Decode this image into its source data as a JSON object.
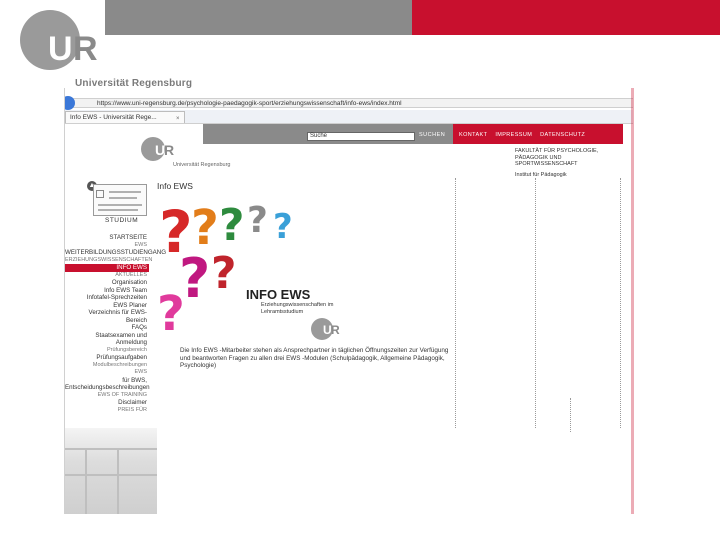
{
  "slide": {
    "brand_gray": "#8a8a8a",
    "brand_red": "#c8102e",
    "logo_letters_left": "U",
    "logo_letters_right": "R",
    "university_name": "Universität Regensburg"
  },
  "browser": {
    "url": "https://www.uni-regensburg.de/psychologie-paedagogik-sport/erziehungswissenschaft/info-ews/index.html",
    "tab_title": "Info EWS - Universität Rege...",
    "tab_close": "×"
  },
  "site_header": {
    "search_placeholder": "Suche",
    "search_button": "SUCHEN",
    "top_links": [
      "KONTAKT",
      "IMPRESSUM",
      "DATENSCHUTZ"
    ],
    "small_logo_name": "Universität Regensburg",
    "faculty_lines": [
      "FAKULTÄT FÜR PSYCHOLOGIE,",
      "PÄDAGOGIK UND",
      "SPORTWISSENSCHAFT"
    ],
    "institute": "Institut für Pädagogik"
  },
  "sidebar": {
    "section_label": "STUDIUM",
    "items": [
      {
        "label": "STARTSEITE",
        "active": false,
        "tiny": false
      },
      {
        "label": "EWS",
        "active": false,
        "tiny": true
      },
      {
        "label": "WEITERBILDUNGSSTUDIENGANG",
        "active": false,
        "tiny": false
      },
      {
        "label": "ERZIEHUNGSWISSENSCHAFTEN",
        "active": false,
        "tiny": true
      },
      {
        "label": "INFO EWS",
        "active": true,
        "tiny": false
      },
      {
        "label": "AKTUELLES",
        "active": false,
        "tiny": true
      },
      {
        "label": "Organisation",
        "active": false,
        "tiny": false
      },
      {
        "label": "Info EWS Team",
        "active": false,
        "tiny": false
      },
      {
        "label": "Infotafel-Sprechzeiten",
        "active": false,
        "tiny": false
      },
      {
        "label": "EWS Planer",
        "active": false,
        "tiny": false
      },
      {
        "label": "Verzeichnis für EWS-",
        "active": false,
        "tiny": false
      },
      {
        "label": "Bereich",
        "active": false,
        "tiny": false
      },
      {
        "label": "FAQs",
        "active": false,
        "tiny": false
      },
      {
        "label": "Staatsexamen und",
        "active": false,
        "tiny": false
      },
      {
        "label": "Anmeldung",
        "active": false,
        "tiny": false
      },
      {
        "label": "Prüfungsbereich",
        "active": false,
        "tiny": true
      },
      {
        "label": "Prüfungsaufgaben",
        "active": false,
        "tiny": false
      },
      {
        "label": "Modulbeschreibungen",
        "active": false,
        "tiny": true
      },
      {
        "label": "EWS",
        "active": false,
        "tiny": true
      },
      {
        "label": "für BWS,",
        "active": false,
        "tiny": false
      },
      {
        "label": "Entscheidungsbeschreibungen",
        "active": false,
        "tiny": false
      },
      {
        "label": "EWS OF TRAINING",
        "active": false,
        "tiny": true
      },
      {
        "label": "Disclaimer",
        "active": false,
        "tiny": false
      },
      {
        "label": "PREIS FÜR",
        "active": false,
        "tiny": true
      }
    ]
  },
  "content": {
    "title": "Info EWS",
    "graphic_title": "INFO EWS",
    "graphic_subtitle": "Erziehungswissenschaften im Lehramtsstudium",
    "text": "Die Info EWS -Mitarbeiter stehen als Ansprechpartner in täglichen Öffnungszeiten zur Verfügung und beantworten Fragen zu allen drei EWS -Modulen (Schulpädagogik, Allgemeine Pädagogik, Psychologie)"
  }
}
